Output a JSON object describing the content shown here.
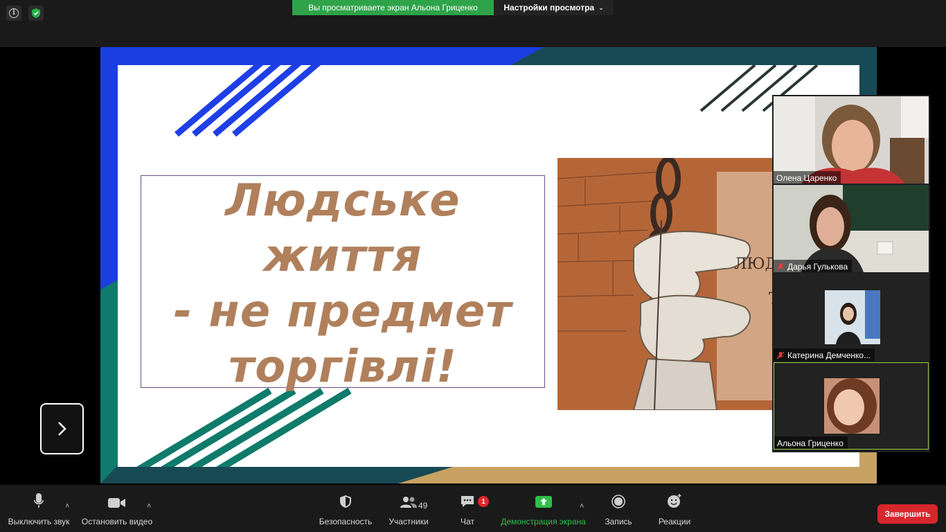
{
  "top_bar": {
    "viewing_banner": "Вы просматриваете экран Альона Гриценко",
    "view_options": "Настройки просмотра",
    "colors": {
      "banner": "#2ea34a"
    }
  },
  "slide": {
    "title": "Людське життя\n- не предмет\nторгівлі!",
    "art_text": "ЛЮД\nТО",
    "colors": {
      "title": "#b0805c",
      "stripe_blue": "#1e40e0",
      "stripe_green": "#0f7a68",
      "stripe_dark": "#2a3a3a"
    }
  },
  "participants": [
    {
      "name": "Олена Царенко",
      "muted": false
    },
    {
      "name": "Дарья Гулькова",
      "muted": true
    },
    {
      "name": "Катерина Демченко...",
      "muted": true
    },
    {
      "name": "Альона Гриценко",
      "muted": false,
      "active_speaker": true
    }
  ],
  "toolbar": {
    "mute_label": "Выключить звук",
    "video_label": "Остановить видео",
    "security_label": "Безопасность",
    "participants_label": "Участники",
    "participants_count": "49",
    "chat_label": "Чат",
    "chat_badge": "1",
    "share_label": "Демонстрация экрана",
    "record_label": "Запись",
    "reactions_label": "Реакции",
    "end_label": "Завершить",
    "colors": {
      "share_green": "#2fbf4a",
      "end_red": "#d6272c"
    }
  },
  "icons": [
    "info-icon",
    "shield-icon",
    "chevron-down-icon",
    "next-arrow-icon",
    "microphone-icon",
    "video-camera-icon",
    "security-shield-icon",
    "participants-icon",
    "chat-icon",
    "share-screen-icon",
    "record-icon",
    "reactions-icon",
    "muted-mic-icon"
  ]
}
